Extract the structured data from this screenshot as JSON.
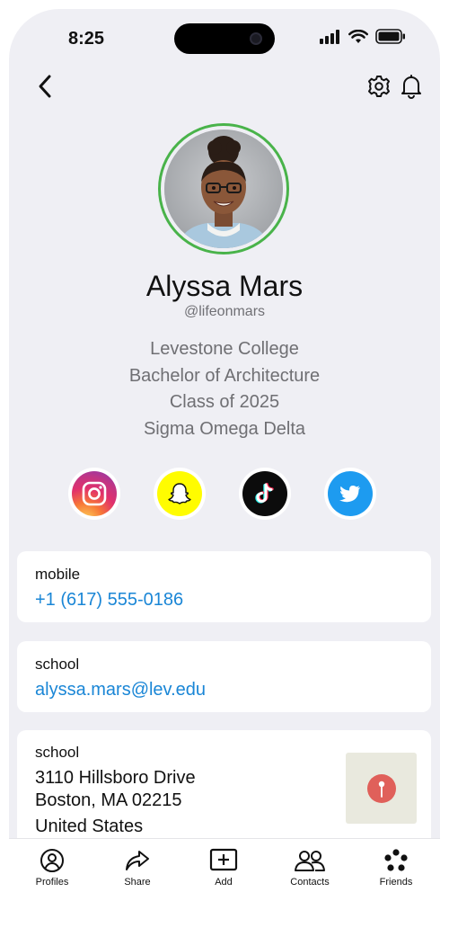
{
  "status": {
    "time": "8:25"
  },
  "profile": {
    "name": "Alyssa Mars",
    "handle": "@lifeonmars",
    "bio": [
      "Levestone College",
      "Bachelor of Architecture",
      "Class of 2025",
      "Sigma Omega Delta"
    ]
  },
  "socials": [
    {
      "icon": "instagram-icon"
    },
    {
      "icon": "snapchat-icon"
    },
    {
      "icon": "tiktok-icon"
    },
    {
      "icon": "twitter-icon"
    }
  ],
  "cards": {
    "mobile": {
      "label": "mobile",
      "value": "+1 (617) 555-0186"
    },
    "email": {
      "label": "school",
      "value": "alyssa.mars@lev.edu"
    },
    "address": {
      "label": "school",
      "line1": "3110 Hillsboro Drive",
      "line2": "Boston, MA 02215",
      "line3": "United States"
    }
  },
  "tabs": [
    {
      "label": "Profiles",
      "icon": "person-circle-icon"
    },
    {
      "label": "Share",
      "icon": "share-arrow-icon"
    },
    {
      "label": "Add",
      "icon": "plus-square-icon"
    },
    {
      "label": "Contacts",
      "icon": "contacts-icon"
    },
    {
      "label": "Friends",
      "icon": "friends-icon"
    }
  ],
  "colors": {
    "link": "#1a86d6",
    "avatar_ring": "#49b34a",
    "background": "#efeff4",
    "map_pin": "#e0605a"
  }
}
